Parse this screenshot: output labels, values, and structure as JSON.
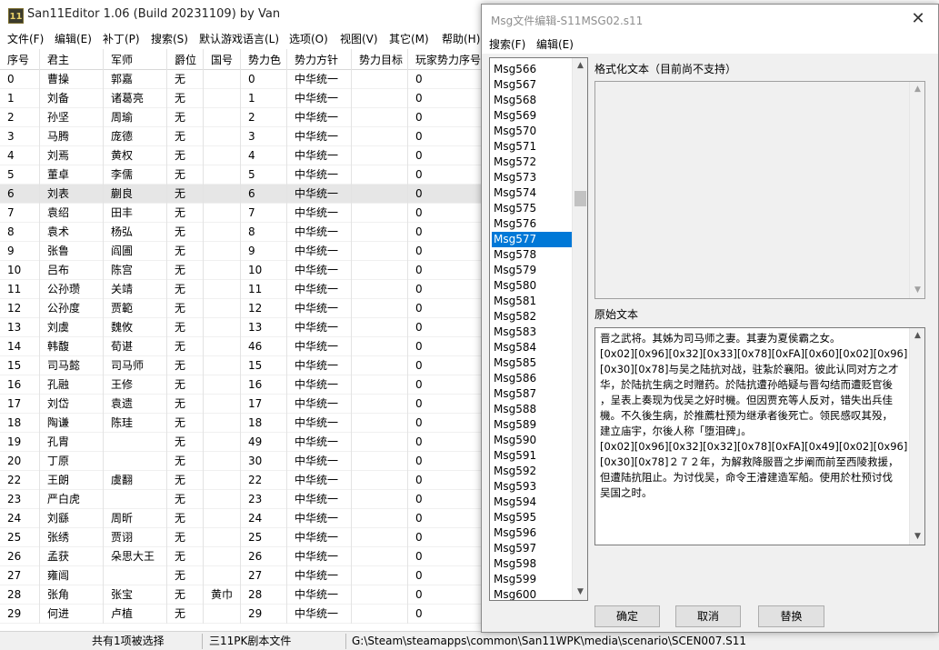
{
  "window": {
    "icon_text": "11",
    "title": "San11Editor 1.06 (Build 20231109) by Van",
    "menu": [
      "文件(F)",
      "编辑(E)",
      "补丁(P)",
      "搜索(S)",
      "默认游戏语言(L)",
      "选项(O)",
      "视图(V)",
      "其它(M)",
      "帮助(H)"
    ]
  },
  "table": {
    "columns": [
      "序号",
      "君主",
      "军师",
      "爵位",
      "国号",
      "势力色",
      "势力方针",
      "势力目标",
      "玩家势力序号"
    ],
    "selected_index": 6,
    "rows": [
      [
        "0",
        "曹操",
        "郭嘉",
        "无",
        "",
        "0",
        "中华统一",
        "",
        "0"
      ],
      [
        "1",
        "刘备",
        "诸葛亮",
        "无",
        "",
        "1",
        "中华统一",
        "",
        "0"
      ],
      [
        "2",
        "孙坚",
        "周瑜",
        "无",
        "",
        "2",
        "中华统一",
        "",
        "0"
      ],
      [
        "3",
        "马腾",
        "庞德",
        "无",
        "",
        "3",
        "中华统一",
        "",
        "0"
      ],
      [
        "4",
        "刘焉",
        "黄权",
        "无",
        "",
        "4",
        "中华统一",
        "",
        "0"
      ],
      [
        "5",
        "董卓",
        "李儒",
        "无",
        "",
        "5",
        "中华统一",
        "",
        "0"
      ],
      [
        "6",
        "刘表",
        "蒯良",
        "无",
        "",
        "6",
        "中华统一",
        "",
        "0"
      ],
      [
        "7",
        "袁绍",
        "田丰",
        "无",
        "",
        "7",
        "中华统一",
        "",
        "0"
      ],
      [
        "8",
        "袁术",
        "杨弘",
        "无",
        "",
        "8",
        "中华统一",
        "",
        "0"
      ],
      [
        "9",
        "张鲁",
        "阎圃",
        "无",
        "",
        "9",
        "中华统一",
        "",
        "0"
      ],
      [
        "10",
        "吕布",
        "陈宫",
        "无",
        "",
        "10",
        "中华统一",
        "",
        "0"
      ],
      [
        "11",
        "公孙瓒",
        "关靖",
        "无",
        "",
        "11",
        "中华统一",
        "",
        "0"
      ],
      [
        "12",
        "公孙度",
        "贾範",
        "无",
        "",
        "12",
        "中华统一",
        "",
        "0"
      ],
      [
        "13",
        "刘虞",
        "魏攸",
        "无",
        "",
        "13",
        "中华统一",
        "",
        "0"
      ],
      [
        "14",
        "韩馥",
        "荀谌",
        "无",
        "",
        "46",
        "中华统一",
        "",
        "0"
      ],
      [
        "15",
        "司马懿",
        "司马师",
        "无",
        "",
        "15",
        "中华统一",
        "",
        "0"
      ],
      [
        "16",
        "孔融",
        "王修",
        "无",
        "",
        "16",
        "中华统一",
        "",
        "0"
      ],
      [
        "17",
        "刘岱",
        "袁遗",
        "无",
        "",
        "17",
        "中华统一",
        "",
        "0"
      ],
      [
        "18",
        "陶谦",
        "陈珪",
        "无",
        "",
        "18",
        "中华统一",
        "",
        "0"
      ],
      [
        "19",
        "孔胄",
        "",
        "无",
        "",
        "49",
        "中华统一",
        "",
        "0"
      ],
      [
        "20",
        "丁原",
        "",
        "无",
        "",
        "30",
        "中华统一",
        "",
        "0"
      ],
      [
        "22",
        "王朗",
        "虞翻",
        "无",
        "",
        "22",
        "中华统一",
        "",
        "0"
      ],
      [
        "23",
        "严白虎",
        "",
        "无",
        "",
        "23",
        "中华统一",
        "",
        "0"
      ],
      [
        "24",
        "刘繇",
        "周昕",
        "无",
        "",
        "24",
        "中华统一",
        "",
        "0"
      ],
      [
        "25",
        "张绣",
        "贾诩",
        "无",
        "",
        "25",
        "中华统一",
        "",
        "0"
      ],
      [
        "26",
        "孟获",
        "朵思大王",
        "无",
        "",
        "26",
        "中华统一",
        "",
        "0"
      ],
      [
        "27",
        "雍闿",
        "",
        "无",
        "",
        "27",
        "中华统一",
        "",
        "0"
      ],
      [
        "28",
        "张角",
        "张宝",
        "无",
        "黄巾",
        "28",
        "中华统一",
        "",
        "0"
      ],
      [
        "29",
        "何进",
        "卢植",
        "无",
        "",
        "29",
        "中华统一",
        "",
        "0"
      ]
    ]
  },
  "status": {
    "selection": "共有1项被选择",
    "file_type": "三11PK剧本文件",
    "path": "G:\\Steam\\steamapps\\common\\San11WPK\\media\\scenario\\SCEN007.S11"
  },
  "dialog": {
    "title": "Msg文件编辑-S11MSG02.s11",
    "close_glyph": "✕",
    "menu": [
      "搜索(F)",
      "编辑(E)"
    ],
    "msg_list": {
      "selected": "Msg577",
      "items": [
        "Msg566",
        "Msg567",
        "Msg568",
        "Msg569",
        "Msg570",
        "Msg571",
        "Msg572",
        "Msg573",
        "Msg574",
        "Msg575",
        "Msg576",
        "Msg577",
        "Msg578",
        "Msg579",
        "Msg580",
        "Msg581",
        "Msg582",
        "Msg583",
        "Msg584",
        "Msg585",
        "Msg586",
        "Msg587",
        "Msg588",
        "Msg589",
        "Msg590",
        "Msg591",
        "Msg592",
        "Msg593",
        "Msg594",
        "Msg595",
        "Msg596",
        "Msg597",
        "Msg598",
        "Msg599",
        "Msg600"
      ]
    },
    "formatted_label": "格式化文本（目前尚不支持）",
    "raw_label": "原始文本",
    "raw_text_lines": [
      "晋之武将。其姊为司马师之妻。其妻为夏侯霸之女。",
      "[0x02][0x96][0x32][0x33][0x78][0xFA][0x60][0x02][0x96]",
      "[0x30][0x78]与吴之陆抗对战，驻紮於襄阳。彼此认同对方之才",
      "华，於陆抗生病之时赠药。於陆抗遭孙皓疑与晋勾结而遭贬官後",
      "，呈表上奏现为伐吴之好时機。但因贾充等人反对，错失出兵佳",
      "機。不久後生病，於推薦杜预为继承者後死亡。领民感叹其殁，",
      "建立庙宇，尔後人称「堕泪碑」。",
      "[0x02][0x96][0x32][0x32][0x78][0xFA][0x49][0x02][0x96]",
      "[0x30][0x78]２７２年，为解救降服晋之步阐而前至西陵救援，",
      "但遭陆抗阻止。为讨伐吴，命令王濬建造军船。使用於杜预讨伐",
      "吴国之时。"
    ],
    "buttons": {
      "ok": "确定",
      "cancel": "取消",
      "replace": "替换"
    },
    "scroll_up": "▲",
    "scroll_down": "▼"
  }
}
